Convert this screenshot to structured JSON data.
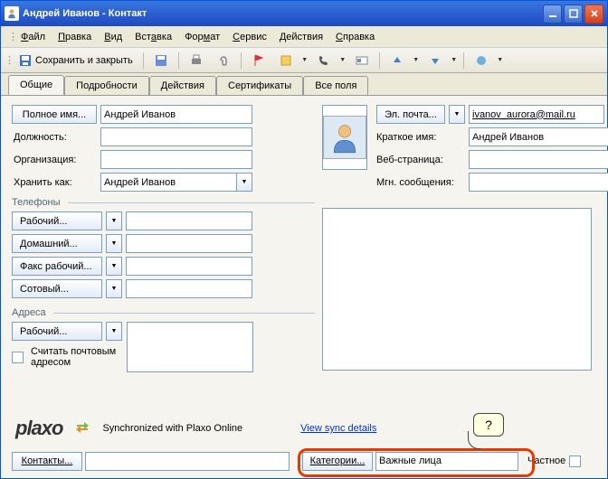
{
  "title": "Андрей Иванов - Контакт",
  "menu": {
    "file": "Файл",
    "edit": "Правка",
    "view": "Вид",
    "insert": "Вставка",
    "format": "Формат",
    "service": "Сервис",
    "actions": "Действия",
    "help": "Справка"
  },
  "toolbar": {
    "save_close": "Сохранить и закрыть"
  },
  "tabs": {
    "general": "Общие",
    "details": "Подробности",
    "actions": "Действия",
    "certs": "Сертификаты",
    "all": "Все поля"
  },
  "fields": {
    "fullname_btn": "Полное имя...",
    "fullname_val": "Андрей Иванов",
    "jobtitle": "Должность:",
    "jobtitle_val": "",
    "org": "Организация:",
    "org_val": "",
    "fileas": "Хранить как:",
    "fileas_val": "Андрей Иванов",
    "email_btn": "Эл. почта...",
    "email_val": "ivanov_aurora@mail.ru",
    "displayname": "Краткое имя:",
    "displayname_val": "Андрей Иванов",
    "webpage": "Веб-страница:",
    "webpage_val": "",
    "im": "Мгн. сообщения:",
    "im_val": ""
  },
  "phones": {
    "section": "Телефоны",
    "work": "Рабочий...",
    "work_val": "",
    "home": "Домашний...",
    "home_val": "",
    "fax": "Факс рабочий...",
    "fax_val": "",
    "mobile": "Сотовый...",
    "mobile_val": ""
  },
  "addresses": {
    "section": "Адреса",
    "work": "Рабочий...",
    "work_val": "",
    "mailing_cb": "Считать почтовым адресом"
  },
  "plaxo": {
    "sync": "Synchronized with Plaxo Online",
    "details": "View sync details"
  },
  "bottom": {
    "contacts": "Контакты...",
    "contacts_val": "",
    "categories": "Категории...",
    "categories_val": "Важные лица",
    "private": "Частное"
  },
  "bubble": "?"
}
